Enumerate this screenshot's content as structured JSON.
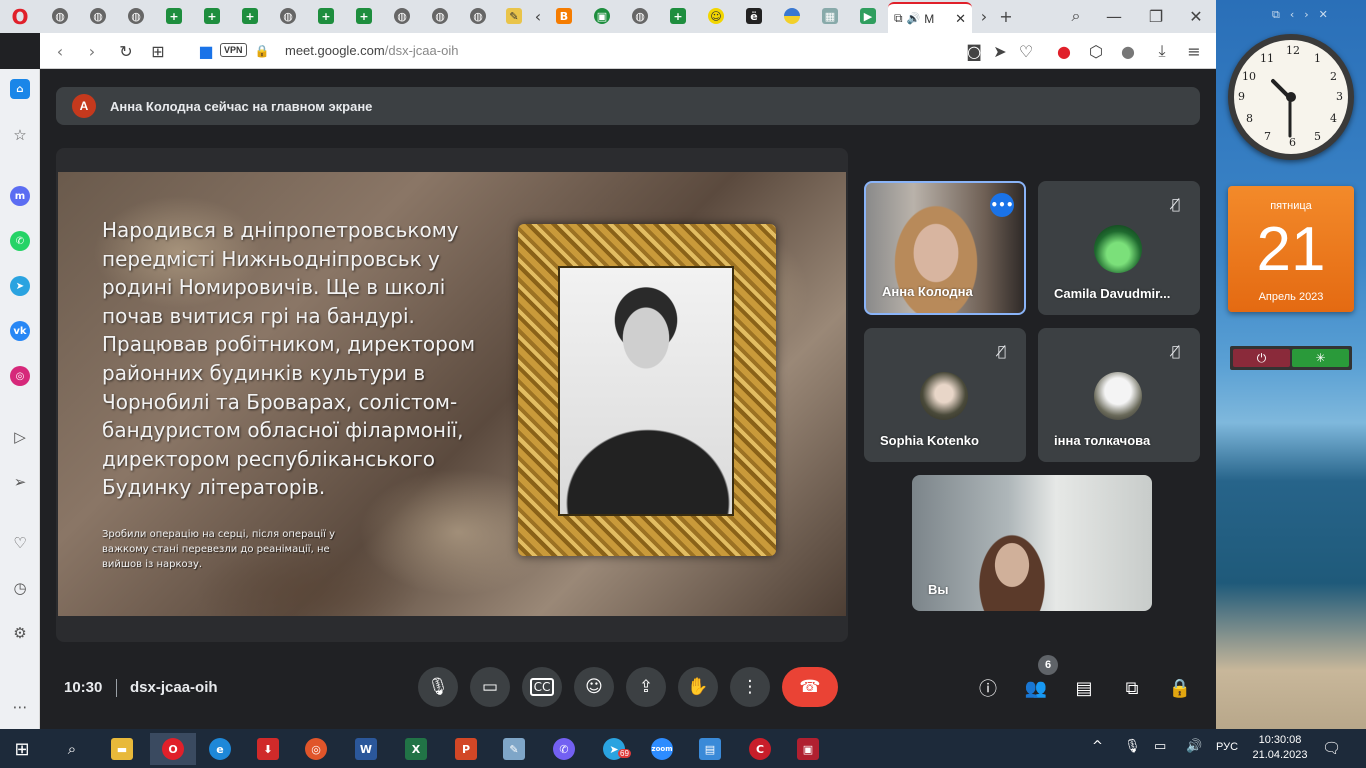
{
  "browser": {
    "active_tab_title": "M",
    "url_host": "meet.google.com",
    "url_path": "/dsx-jcaa-oih",
    "vpn_label": "VPN"
  },
  "meet": {
    "banner_avatar_letter": "A",
    "banner_text": "Анна Колодна сейчас на главном экране",
    "slide": {
      "main_text": "Народився в дніпропетровському передмісті Нижньодніпровськ у родині Номировичів. Ще в школі почав вчитися грі на бандурі. Працював робітником, директором районних будинків культури в Чорнобилі та Броварах, солістом-бандуристом обласної філармонії, директором республіканського Будинку літераторів.",
      "note_text": "Зробили операцію на серці, після операції у важкому стані перевезли до реанімації, не вийшов із наркозу."
    },
    "participants": [
      {
        "name": "Анна Колодна"
      },
      {
        "name": "Camila Davudmir..."
      },
      {
        "name": "Sophia Kotenko"
      },
      {
        "name": "інна толкачова"
      },
      {
        "name": "Вы"
      }
    ],
    "time": "10:30",
    "meeting_code": "dsx-jcaa-oih",
    "people_count": "6",
    "more_badge": "•••"
  },
  "desktop": {
    "clock_time": "10:30",
    "calendar_day": "пятница",
    "calendar_date": "21",
    "calendar_month": "Апрель 2023"
  },
  "taskbar": {
    "language": "РУС",
    "tray_time": "10:30:08",
    "tray_date": "21.04.2023",
    "telegram_badge": "69"
  },
  "colors": {
    "meet_bg": "#202124",
    "end_call": "#ea4335",
    "active_speaker_border": "#8ab4f8"
  }
}
